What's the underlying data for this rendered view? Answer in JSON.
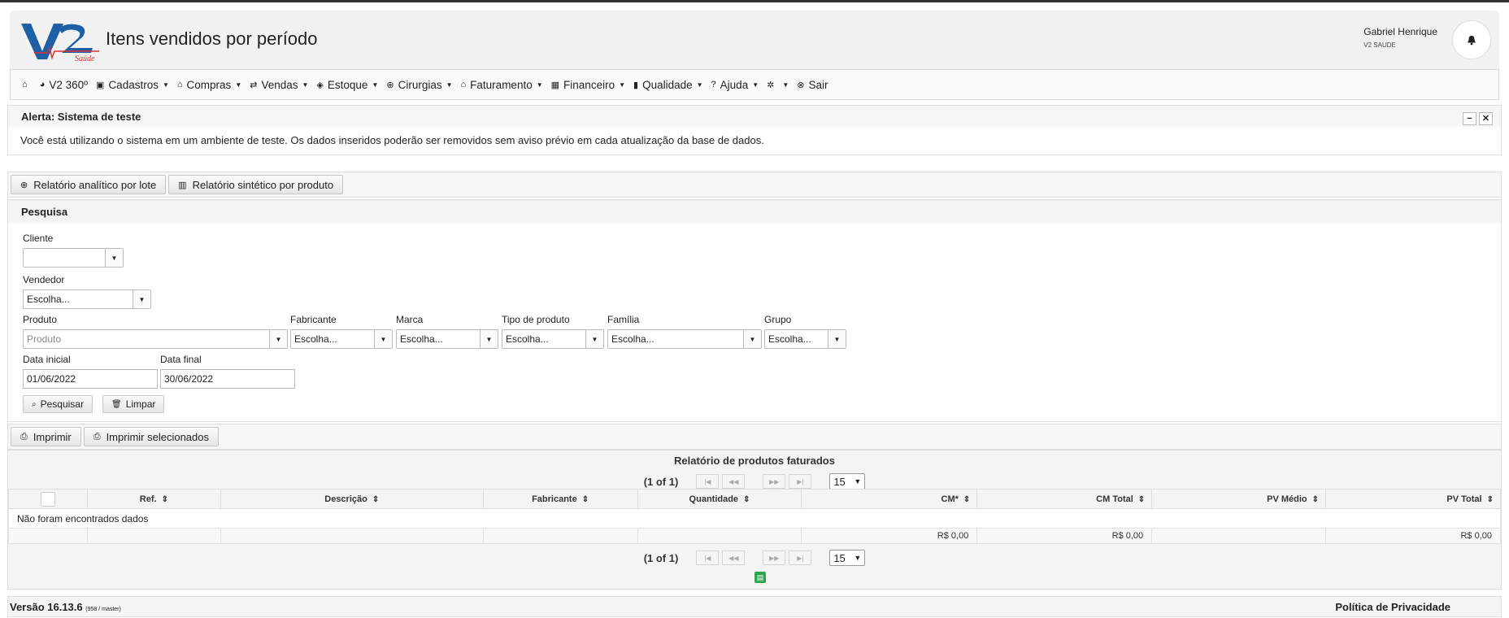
{
  "header": {
    "title": "Itens vendidos por período",
    "user_name": "Gabriel Henrique",
    "user_org": "V2 SAUDE",
    "logo_text": "V2 Saúde"
  },
  "menu": [
    {
      "label": "",
      "icon": "home-icon"
    },
    {
      "label": "V2 360º",
      "icon": "pie-chart-icon"
    },
    {
      "label": "Cadastros",
      "icon": "save-icon"
    },
    {
      "label": "Compras",
      "icon": "bank-icon"
    },
    {
      "label": "Vendas",
      "icon": "transfer-icon"
    },
    {
      "label": "Estoque",
      "icon": "tag-icon"
    },
    {
      "label": "Cirurgias",
      "icon": "plus-circle-icon"
    },
    {
      "label": "Faturamento",
      "icon": "bank-icon"
    },
    {
      "label": "Financeiro",
      "icon": "calculator-icon"
    },
    {
      "label": "Qualidade",
      "icon": "book-icon"
    },
    {
      "label": "Ajuda",
      "icon": "question-icon"
    },
    {
      "label": "",
      "icon": "gear-icon"
    },
    {
      "label": "Sair",
      "icon": "close-circle-icon"
    }
  ],
  "alert": {
    "title": "Alerta: Sistema de teste",
    "message": "Você está utilizando o sistema em um ambiente de teste. Os dados inseridos poderão ser removidos sem aviso prévio em cada atualização da base de dados."
  },
  "report_buttons": {
    "analytic": "Relatório analítico por lote",
    "synthetic": "Relatório sintético por produto"
  },
  "search": {
    "title": "Pesquisa",
    "cliente_label": "Cliente",
    "cliente_value": "",
    "vendedor_label": "Vendedor",
    "vendedor_value": "Escolha...",
    "produto_label": "Produto",
    "produto_placeholder": "Produto",
    "fabricante_label": "Fabricante",
    "fabricante_value": "Escolha...",
    "marca_label": "Marca",
    "marca_value": "Escolha...",
    "tipo_label": "Tipo de produto",
    "tipo_value": "Escolha...",
    "familia_label": "Família",
    "familia_value": "Escolha...",
    "grupo_label": "Grupo",
    "grupo_value": "Escolha...",
    "data_inicial_label": "Data inicial",
    "data_inicial_value": "01/06/2022",
    "data_final_label": "Data final",
    "data_final_value": "30/06/2022",
    "search_button": "Pesquisar",
    "clear_button": "Limpar"
  },
  "print_buttons": {
    "print": "Imprimir",
    "print_selected": "Imprimir selecionados"
  },
  "report": {
    "title": "Relatório de produtos faturados",
    "page_info": "(1 of 1)",
    "rows_per_page": "15",
    "columns": [
      "Ref.",
      "Descrição",
      "Fabricante",
      "Quantidade",
      "CM*",
      "CM Total",
      "PV Médio",
      "PV Total"
    ],
    "empty_message": "Não foram encontrados dados",
    "totals": {
      "cm": "R$ 0,00",
      "cm_total": "R$ 0,00",
      "pv_total": "R$ 0,00"
    }
  },
  "footer": {
    "version": "Versão 16.13.6",
    "build": "(958 / master)",
    "privacy": "Política de Privacidade"
  }
}
